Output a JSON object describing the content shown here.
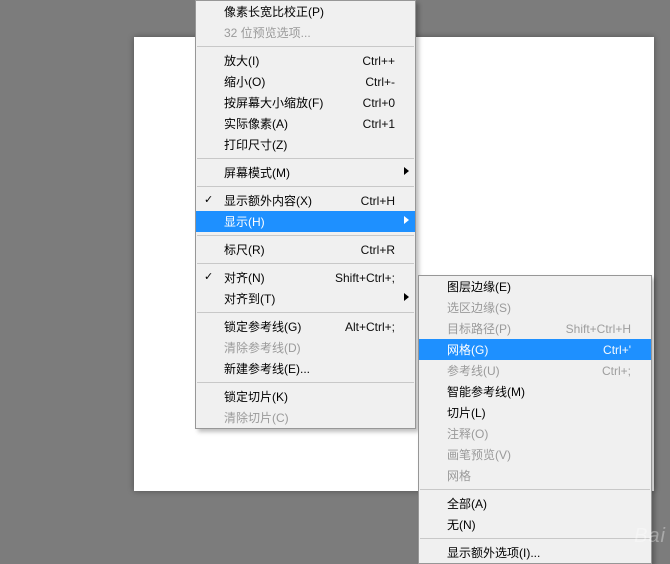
{
  "main_menu": {
    "group0": [
      {
        "label": "像素长宽比校正(P)",
        "shortcut": "",
        "disabled": false
      },
      {
        "label": "32 位预览选项...",
        "shortcut": "",
        "disabled": true
      }
    ],
    "group1": [
      {
        "label": "放大(I)",
        "shortcut": "Ctrl++"
      },
      {
        "label": "缩小(O)",
        "shortcut": "Ctrl+-"
      },
      {
        "label": "按屏幕大小缩放(F)",
        "shortcut": "Ctrl+0"
      },
      {
        "label": "实际像素(A)",
        "shortcut": "Ctrl+1"
      },
      {
        "label": "打印尺寸(Z)",
        "shortcut": ""
      }
    ],
    "group2": [
      {
        "label": "屏幕模式(M)",
        "shortcut": "",
        "submenu": true
      }
    ],
    "group3": [
      {
        "label": "显示额外内容(X)",
        "shortcut": "Ctrl+H",
        "checked": true
      },
      {
        "label": "显示(H)",
        "shortcut": "",
        "submenu": true,
        "highlight": true
      }
    ],
    "group4": [
      {
        "label": "标尺(R)",
        "shortcut": "Ctrl+R"
      }
    ],
    "group5": [
      {
        "label": "对齐(N)",
        "shortcut": "Shift+Ctrl+;",
        "checked": true
      },
      {
        "label": "对齐到(T)",
        "shortcut": "",
        "submenu": true
      }
    ],
    "group6": [
      {
        "label": "锁定参考线(G)",
        "shortcut": "Alt+Ctrl+;"
      },
      {
        "label": "清除参考线(D)",
        "shortcut": "",
        "disabled": true
      },
      {
        "label": "新建参考线(E)...",
        "shortcut": ""
      }
    ],
    "group7": [
      {
        "label": "锁定切片(K)",
        "shortcut": ""
      },
      {
        "label": "清除切片(C)",
        "shortcut": "",
        "disabled": true
      }
    ]
  },
  "sub_menu": {
    "group0": [
      {
        "label": "图层边缘(E)",
        "shortcut": ""
      },
      {
        "label": "选区边缘(S)",
        "shortcut": "",
        "disabled": true
      },
      {
        "label": "目标路径(P)",
        "shortcut": "Shift+Ctrl+H",
        "disabled": true
      },
      {
        "label": "网格(G)",
        "shortcut": "Ctrl+'",
        "highlight": true
      },
      {
        "label": "参考线(U)",
        "shortcut": "Ctrl+;",
        "disabled": true
      },
      {
        "label": "智能参考线(M)",
        "shortcut": ""
      },
      {
        "label": "切片(L)",
        "shortcut": ""
      },
      {
        "label": "注释(O)",
        "shortcut": "",
        "disabled": true
      },
      {
        "label": "画笔预览(V)",
        "shortcut": "",
        "disabled": true
      },
      {
        "label": "网格",
        "shortcut": "",
        "disabled": true
      }
    ],
    "group1": [
      {
        "label": "全部(A)",
        "shortcut": ""
      },
      {
        "label": "无(N)",
        "shortcut": ""
      }
    ],
    "group2": [
      {
        "label": "显示额外选项(I)...",
        "shortcut": ""
      }
    ]
  },
  "watermark": "Bai"
}
